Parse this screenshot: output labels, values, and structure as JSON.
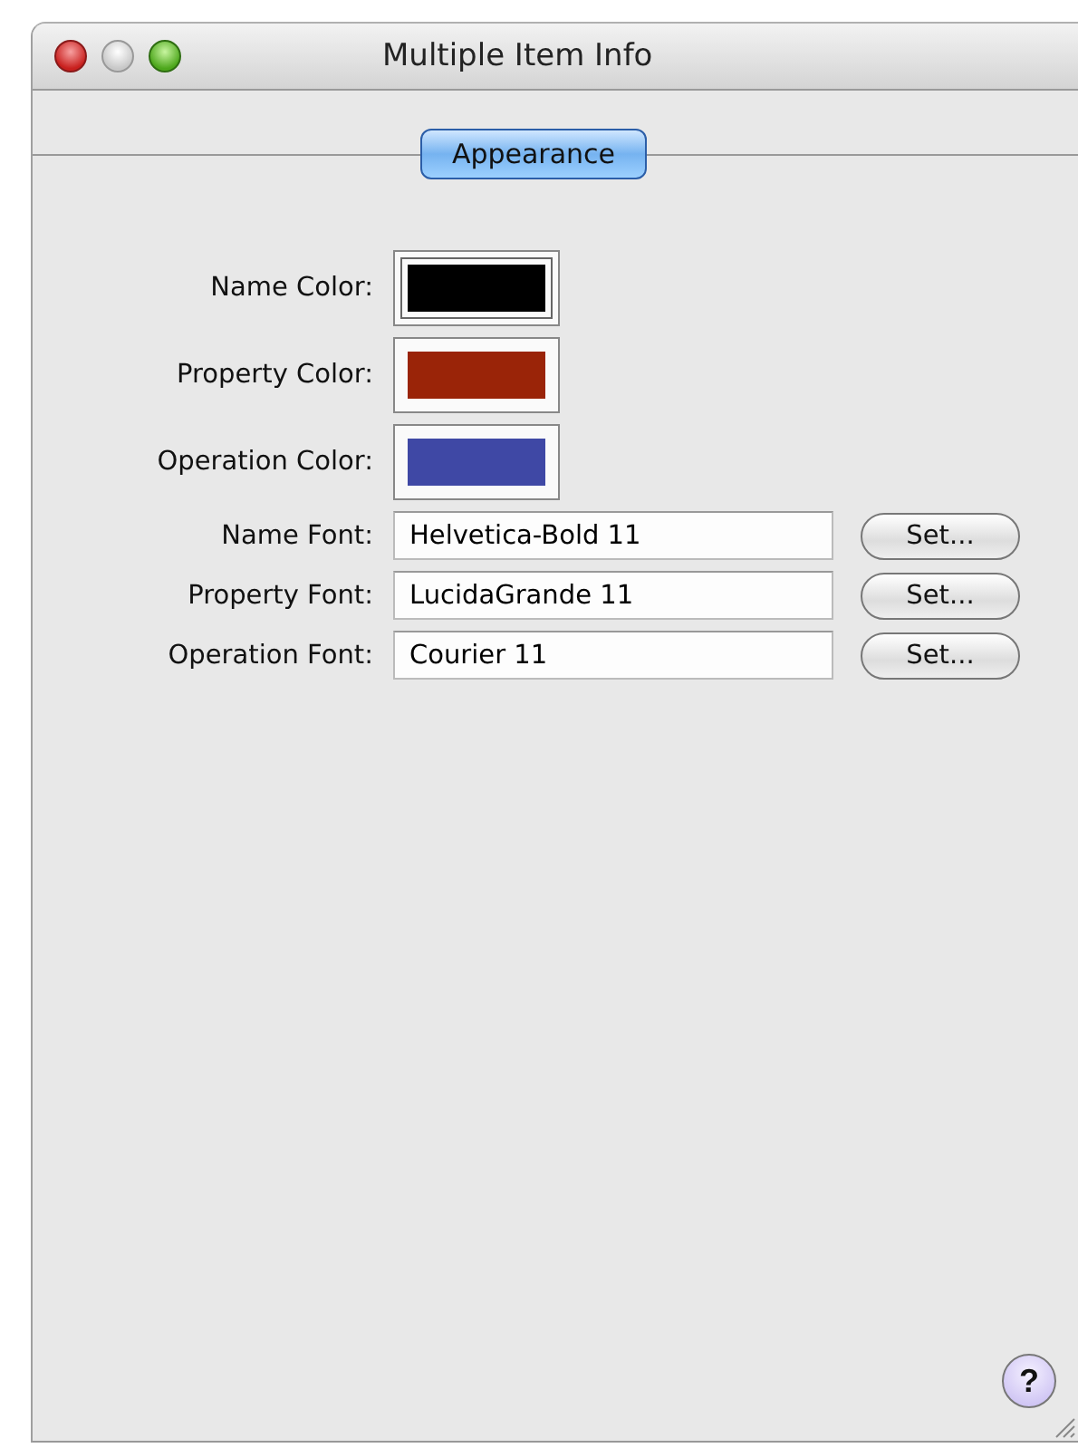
{
  "window": {
    "title": "Multiple Item Info"
  },
  "tabs": [
    {
      "label": "Appearance",
      "selected": true
    }
  ],
  "colors": [
    {
      "label": "Name Color:",
      "color": "#000000",
      "selected": true
    },
    {
      "label": "Property Color:",
      "color": "#9a2408",
      "selected": false
    },
    {
      "label": "Operation Color:",
      "color": "#3f48a5",
      "selected": false
    }
  ],
  "fonts": [
    {
      "label": "Name Font:",
      "value": "Helvetica-Bold 11",
      "button": "Set..."
    },
    {
      "label": "Property Font:",
      "value": "LucidaGrande 11",
      "button": "Set..."
    },
    {
      "label": "Operation Font:",
      "value": "Courier 11",
      "button": "Set..."
    }
  ],
  "help_button": "?"
}
